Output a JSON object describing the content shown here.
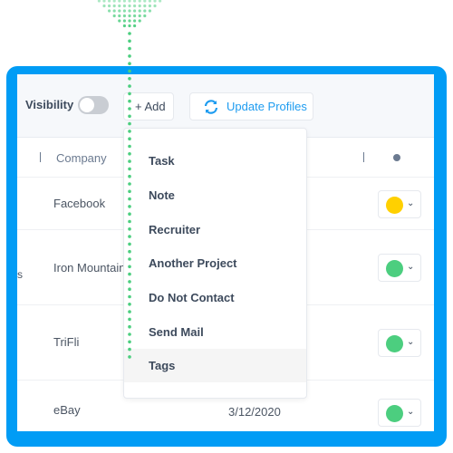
{
  "toolbar": {
    "visibility_label": "Visibility",
    "visibility_on": false,
    "add_label": "+ Add",
    "update_label": "Update Profiles"
  },
  "table": {
    "company_header": "Company",
    "rows": [
      {
        "company": "Facebook",
        "date": "",
        "status_color": "#ffd000"
      },
      {
        "company": "Iron Mountain",
        "date": "",
        "status_color": "#4cce7f"
      },
      {
        "company": "TriFli",
        "date": "",
        "status_color": "#4cce7f"
      },
      {
        "company": "eBay",
        "date": "3/12/2020",
        "status_color": "#4cce7f"
      }
    ],
    "stray_text": "s"
  },
  "add_menu": {
    "items": [
      "Task",
      "Note",
      "Recruiter",
      "Another Project",
      "Do Not Contact",
      "Send Mail",
      "Tags"
    ],
    "highlighted": "Tags"
  },
  "colors": {
    "frame": "#019cf5",
    "accent": "#1e9cf0",
    "dotted_guide": "#4cce7f"
  }
}
